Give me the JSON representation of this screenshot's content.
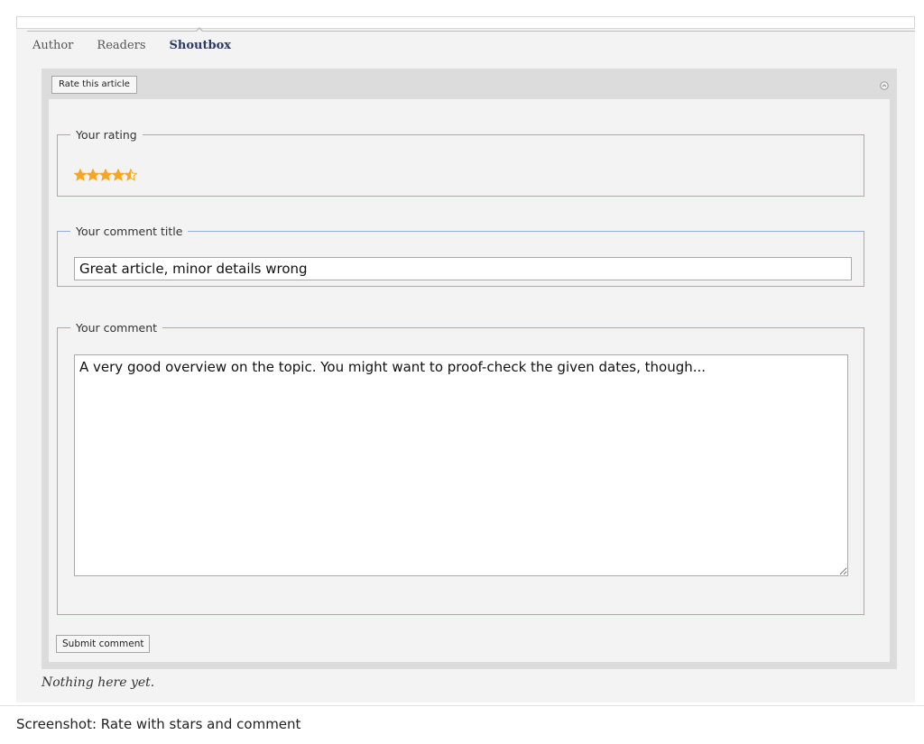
{
  "tabs": [
    {
      "label": "Author",
      "active": false
    },
    {
      "label": "Readers",
      "active": false
    },
    {
      "label": "Shoutbox",
      "active": true
    }
  ],
  "panel": {
    "rate_button_label": "Rate this article",
    "collapse_icon": "circle-collapse-icon"
  },
  "rating": {
    "legend": "Your rating",
    "stars_filled": 4.5,
    "stars_total": 5,
    "star_color": "#f5a623"
  },
  "comment_title": {
    "legend": "Your comment title",
    "value": "Great article, minor details wrong"
  },
  "comment": {
    "legend": "Your comment",
    "value": "A very good overview on the topic. You might want to proof-check the given dates, though..."
  },
  "submit_label": "Submit comment",
  "empty_note": "Nothing here yet.",
  "caption": "Screenshot: Rate with stars and comment",
  "colors": {
    "fieldset_border": "#8fb0d0",
    "active_tab": "#2b3a67",
    "panel_bg": "#dcdcdc"
  }
}
